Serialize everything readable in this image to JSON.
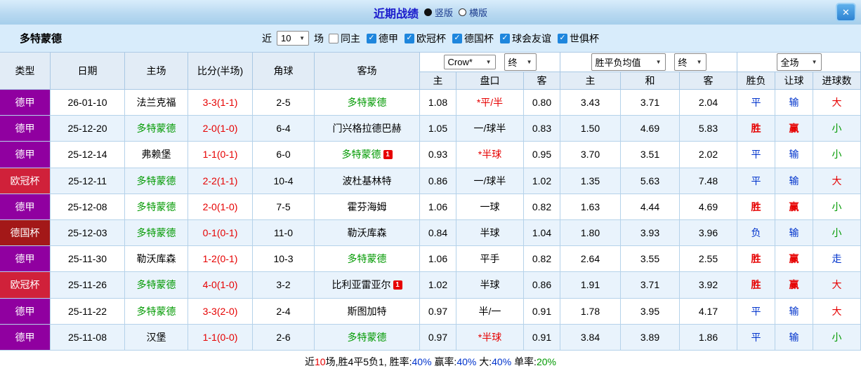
{
  "icons": {
    "close": "✕",
    "dropdown_arrow": "▼",
    "check": "✓"
  },
  "colors": {
    "title_blue": "#1a1acc",
    "league_purple": "#9000a0",
    "league_red": "#d0213a",
    "league_darkred": "#a31818",
    "team_green": "#009900",
    "score_red": "#e60000",
    "blue": "#0033cc"
  },
  "titlebar": {
    "title": "近期战绩",
    "radios": [
      {
        "label": "竖版",
        "selected": true
      },
      {
        "label": "横版",
        "selected": false
      }
    ]
  },
  "filter": {
    "team": "多特蒙德",
    "near": "近",
    "count": "10",
    "games": "场",
    "checks": [
      {
        "label": "同主",
        "checked": false
      },
      {
        "label": "德甲",
        "checked": true
      },
      {
        "label": "欧冠杯",
        "checked": true
      },
      {
        "label": "德国杯",
        "checked": true
      },
      {
        "label": "球会友谊",
        "checked": true
      },
      {
        "label": "世俱杯",
        "checked": true
      }
    ]
  },
  "controls": {
    "company": "Crow*",
    "company_time": "终",
    "europe": "胜平负均值",
    "europe_time": "终",
    "scope": "全场"
  },
  "headers": {
    "type": "类型",
    "date": "日期",
    "home": "主场",
    "score": "比分(半场)",
    "corner": "角球",
    "away": "客场",
    "h_home": "主",
    "h_handicap": "盘口",
    "h_away": "客",
    "e_home": "主",
    "e_draw": "和",
    "e_away": "客",
    "result": "胜负",
    "cover": "让球",
    "goals": "进球数"
  },
  "table": {
    "badge_label": "1",
    "rows": [
      {
        "league": "德甲",
        "league_class": "purple",
        "date": "26-01-10",
        "home": {
          "name": "法兰克福",
          "green": false,
          "badge": false
        },
        "score": "3-3(1-1)",
        "corner": "2-5",
        "away": {
          "name": "多特蒙德",
          "green": true,
          "badge": false
        },
        "asian": {
          "home": "1.08",
          "handicap": "*平/半",
          "red": true,
          "away": "0.80"
        },
        "europe": {
          "home": "3.43",
          "draw": "3.71",
          "away": "2.04"
        },
        "result": {
          "text": "平",
          "class": "blue"
        },
        "cover": {
          "text": "输",
          "class": "blue"
        },
        "goals": {
          "text": "大",
          "class": "red"
        }
      },
      {
        "league": "德甲",
        "league_class": "purple",
        "date": "25-12-20",
        "home": {
          "name": "多特蒙德",
          "green": true,
          "badge": false
        },
        "score": "2-0(1-0)",
        "corner": "6-4",
        "away": {
          "name": "门兴格拉德巴赫",
          "green": false,
          "badge": false
        },
        "asian": {
          "home": "1.05",
          "handicap": "一/球半",
          "red": false,
          "away": "0.83"
        },
        "europe": {
          "home": "1.50",
          "draw": "4.69",
          "away": "5.83"
        },
        "result": {
          "text": "胜",
          "class": "red"
        },
        "cover": {
          "text": "赢",
          "class": "red"
        },
        "goals": {
          "text": "小",
          "class": "green"
        }
      },
      {
        "league": "德甲",
        "league_class": "purple",
        "date": "25-12-14",
        "home": {
          "name": "弗赖堡",
          "green": false,
          "badge": false
        },
        "score": "1-1(0-1)",
        "corner": "6-0",
        "away": {
          "name": "多特蒙德",
          "green": true,
          "badge": true
        },
        "asian": {
          "home": "0.93",
          "handicap": "*半球",
          "red": true,
          "away": "0.95"
        },
        "europe": {
          "home": "3.70",
          "draw": "3.51",
          "away": "2.02"
        },
        "result": {
          "text": "平",
          "class": "blue"
        },
        "cover": {
          "text": "输",
          "class": "blue"
        },
        "goals": {
          "text": "小",
          "class": "green"
        }
      },
      {
        "league": "欧冠杯",
        "league_class": "red",
        "date": "25-12-11",
        "home": {
          "name": "多特蒙德",
          "green": true,
          "badge": false
        },
        "score": "2-2(1-1)",
        "corner": "10-4",
        "away": {
          "name": "波杜基林特",
          "green": false,
          "badge": false
        },
        "asian": {
          "home": "0.86",
          "handicap": "一/球半",
          "red": false,
          "away": "1.02"
        },
        "europe": {
          "home": "1.35",
          "draw": "5.63",
          "away": "7.48"
        },
        "result": {
          "text": "平",
          "class": "blue"
        },
        "cover": {
          "text": "输",
          "class": "blue"
        },
        "goals": {
          "text": "大",
          "class": "red"
        }
      },
      {
        "league": "德甲",
        "league_class": "purple",
        "date": "25-12-08",
        "home": {
          "name": "多特蒙德",
          "green": true,
          "badge": false
        },
        "score": "2-0(1-0)",
        "corner": "7-5",
        "away": {
          "name": "霍芬海姆",
          "green": false,
          "badge": false
        },
        "asian": {
          "home": "1.06",
          "handicap": "一球",
          "red": false,
          "away": "0.82"
        },
        "europe": {
          "home": "1.63",
          "draw": "4.44",
          "away": "4.69"
        },
        "result": {
          "text": "胜",
          "class": "red"
        },
        "cover": {
          "text": "赢",
          "class": "red"
        },
        "goals": {
          "text": "小",
          "class": "green"
        }
      },
      {
        "league": "德国杯",
        "league_class": "darkred",
        "date": "25-12-03",
        "home": {
          "name": "多特蒙德",
          "green": true,
          "badge": false
        },
        "score": "0-1(0-1)",
        "corner": "11-0",
        "away": {
          "name": "勒沃库森",
          "green": false,
          "badge": false
        },
        "asian": {
          "home": "0.84",
          "handicap": "半球",
          "red": false,
          "away": "1.04"
        },
        "europe": {
          "home": "1.80",
          "draw": "3.93",
          "away": "3.96"
        },
        "result": {
          "text": "负",
          "class": "blue"
        },
        "cover": {
          "text": "输",
          "class": "blue"
        },
        "goals": {
          "text": "小",
          "class": "green"
        }
      },
      {
        "league": "德甲",
        "league_class": "purple",
        "date": "25-11-30",
        "home": {
          "name": "勒沃库森",
          "green": false,
          "badge": false
        },
        "score": "1-2(0-1)",
        "corner": "10-3",
        "away": {
          "name": "多特蒙德",
          "green": true,
          "badge": false
        },
        "asian": {
          "home": "1.06",
          "handicap": "平手",
          "red": false,
          "away": "0.82"
        },
        "europe": {
          "home": "2.64",
          "draw": "3.55",
          "away": "2.55"
        },
        "result": {
          "text": "胜",
          "class": "red"
        },
        "cover": {
          "text": "赢",
          "class": "red"
        },
        "goals": {
          "text": "走",
          "class": "blue"
        }
      },
      {
        "league": "欧冠杯",
        "league_class": "red",
        "date": "25-11-26",
        "home": {
          "name": "多特蒙德",
          "green": true,
          "badge": false
        },
        "score": "4-0(1-0)",
        "corner": "3-2",
        "away": {
          "name": "比利亚雷亚尔",
          "green": false,
          "badge": true
        },
        "asian": {
          "home": "1.02",
          "handicap": "半球",
          "red": false,
          "away": "0.86"
        },
        "europe": {
          "home": "1.91",
          "draw": "3.71",
          "away": "3.92"
        },
        "result": {
          "text": "胜",
          "class": "red"
        },
        "cover": {
          "text": "赢",
          "class": "red"
        },
        "goals": {
          "text": "大",
          "class": "red"
        }
      },
      {
        "league": "德甲",
        "league_class": "purple",
        "date": "25-11-22",
        "home": {
          "name": "多特蒙德",
          "green": true,
          "badge": false
        },
        "score": "3-3(2-0)",
        "corner": "2-4",
        "away": {
          "name": "斯图加特",
          "green": false,
          "badge": false
        },
        "asian": {
          "home": "0.97",
          "handicap": "半/一",
          "red": false,
          "away": "0.91"
        },
        "europe": {
          "home": "1.78",
          "draw": "3.95",
          "away": "4.17"
        },
        "result": {
          "text": "平",
          "class": "blue"
        },
        "cover": {
          "text": "输",
          "class": "blue"
        },
        "goals": {
          "text": "大",
          "class": "red"
        }
      },
      {
        "league": "德甲",
        "league_class": "purple",
        "date": "25-11-08",
        "home": {
          "name": "汉堡",
          "green": false,
          "badge": false
        },
        "score": "1-1(0-0)",
        "corner": "2-6",
        "away": {
          "name": "多特蒙德",
          "green": true,
          "badge": false
        },
        "asian": {
          "home": "0.97",
          "handicap": "*半球",
          "red": true,
          "away": "0.91"
        },
        "europe": {
          "home": "3.84",
          "draw": "3.89",
          "away": "1.86"
        },
        "result": {
          "text": "平",
          "class": "blue"
        },
        "cover": {
          "text": "输",
          "class": "blue"
        },
        "goals": {
          "text": "小",
          "class": "green"
        }
      }
    ]
  },
  "footer": {
    "parts": [
      {
        "text": "近",
        "class": ""
      },
      {
        "text": "10",
        "class": "red"
      },
      {
        "text": "场,",
        "class": ""
      },
      {
        "text": "胜4平5负1, ",
        "class": ""
      },
      {
        "text": "胜率:",
        "class": ""
      },
      {
        "text": "40%",
        "class": "blue"
      },
      {
        "text": " 赢率:",
        "class": ""
      },
      {
        "text": "40%",
        "class": "blue"
      },
      {
        "text": " 大:",
        "class": ""
      },
      {
        "text": "40%",
        "class": "blue"
      },
      {
        "text": " 单率:",
        "class": ""
      },
      {
        "text": "20%",
        "class": "green"
      }
    ]
  }
}
